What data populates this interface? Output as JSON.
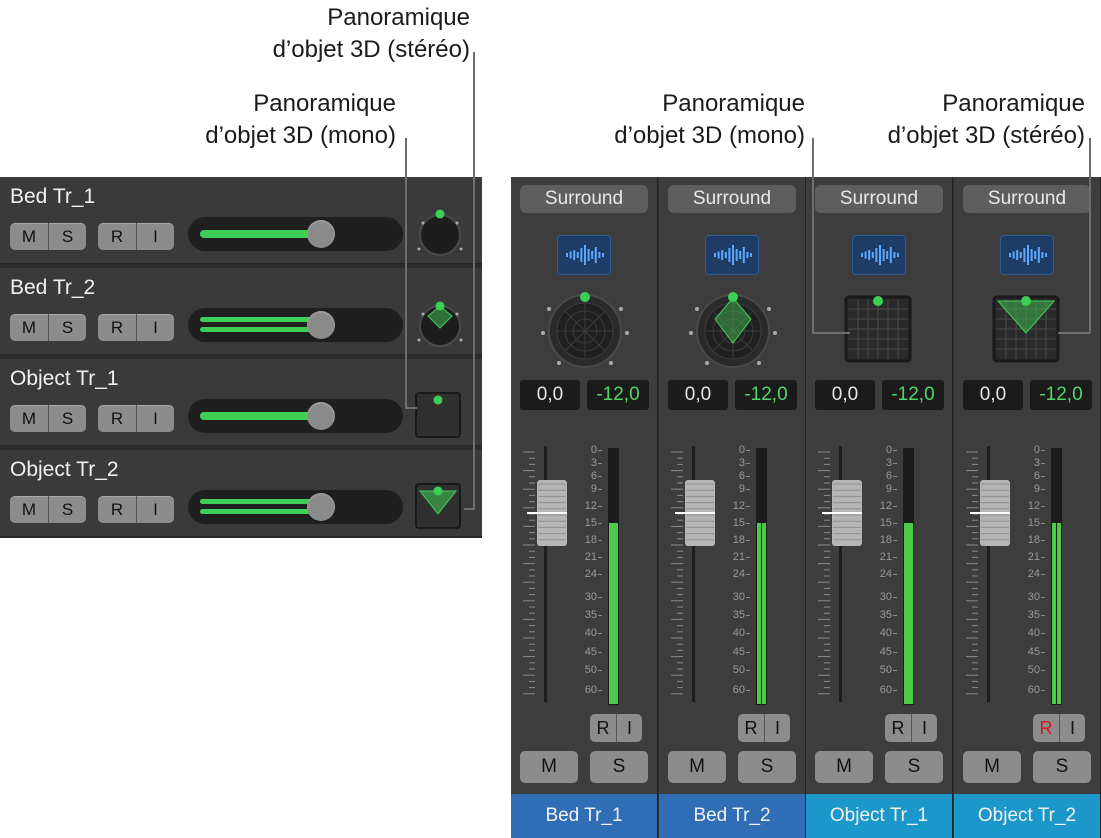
{
  "callouts": {
    "left_stereo": {
      "line1": "Panoramique",
      "line2": "d’objet 3D (stéréo)"
    },
    "left_mono": {
      "line1": "Panoramique",
      "line2": "d’objet 3D (mono)"
    },
    "right_mono": {
      "line1": "Panoramique",
      "line2": "d’objet 3D (mono)"
    },
    "right_stereo": {
      "line1": "Panoramique",
      "line2": "d’objet 3D (stéréo)"
    }
  },
  "tracks": [
    {
      "name": "Bed Tr_1",
      "mute": "M",
      "solo": "S",
      "rec": "R",
      "input": "I",
      "volume_level": 0.63,
      "stereo": false,
      "panner": "surround-knob-mono"
    },
    {
      "name": "Bed Tr_2",
      "mute": "M",
      "solo": "S",
      "rec": "R",
      "input": "I",
      "volume_level": 0.63,
      "stereo": true,
      "panner": "surround-knob-stereo"
    },
    {
      "name": "Object Tr_1",
      "mute": "M",
      "solo": "S",
      "rec": "R",
      "input": "I",
      "volume_level": 0.63,
      "stereo": false,
      "panner": "object-pan-mono"
    },
    {
      "name": "Object Tr_2",
      "mute": "M",
      "solo": "S",
      "rec": "R",
      "input": "I",
      "volume_level": 0.63,
      "stereo": true,
      "panner": "object-pan-stereo"
    }
  ],
  "strips": [
    {
      "output": "Surround",
      "pan_value": "0,0",
      "volume_value": "-12,0",
      "rec": "R",
      "input": "I",
      "mute": "M",
      "solo": "S",
      "name": "Bed Tr_1",
      "meter_channels": 1,
      "meter_level": 0.71,
      "record_armed": false,
      "name_color": "#2f6db5",
      "panner": "surround-knob-mono"
    },
    {
      "output": "Surround",
      "pan_value": "0,0",
      "volume_value": "-12,0",
      "rec": "R",
      "input": "I",
      "mute": "M",
      "solo": "S",
      "name": "Bed Tr_2",
      "meter_channels": 2,
      "meter_level": 0.71,
      "record_armed": false,
      "name_color": "#2f6db5",
      "panner": "surround-knob-stereo"
    },
    {
      "output": "Surround",
      "pan_value": "0,0",
      "volume_value": "-12,0",
      "rec": "R",
      "input": "I",
      "mute": "M",
      "solo": "S",
      "name": "Object Tr_1",
      "meter_channels": 1,
      "meter_level": 0.71,
      "record_armed": false,
      "name_color": "#1c97c9",
      "panner": "object-pan-mono"
    },
    {
      "output": "Surround",
      "pan_value": "0,0",
      "volume_value": "-12,0",
      "rec": "R",
      "input": "I",
      "mute": "M",
      "solo": "S",
      "name": "Object Tr_2",
      "meter_channels": 2,
      "meter_level": 0.71,
      "record_armed": true,
      "name_color": "#1c97c9",
      "panner": "object-pan-stereo"
    }
  ],
  "meter_scale": [
    "0",
    "3",
    "6",
    "9",
    "12",
    "15",
    "18",
    "21",
    "24",
    "30",
    "35",
    "40",
    "45",
    "50",
    "60"
  ],
  "colors": {
    "accent_green": "#3ccf55",
    "record_red": "#d21b1b",
    "bed_track": "#2f6db5",
    "object_track": "#1c97c9"
  }
}
